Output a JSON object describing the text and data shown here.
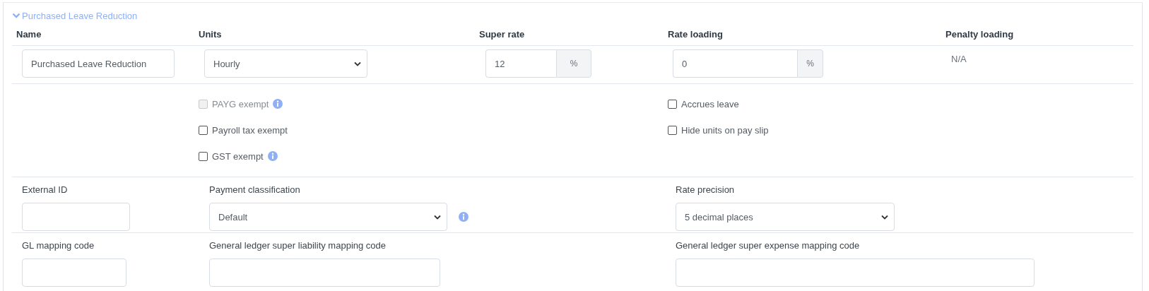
{
  "section": {
    "title": "Purchased Leave Reduction",
    "expanded": true
  },
  "columns": [
    "Name",
    "Units",
    "Super rate",
    "Rate loading",
    "Penalty loading"
  ],
  "name_field": {
    "value": "Purchased Leave Reduction"
  },
  "units_select": {
    "value": "Hourly"
  },
  "super_rate": {
    "value": "12",
    "suffix": "%"
  },
  "rate_loading": {
    "value": "0",
    "suffix": "%"
  },
  "penalty_loading": "N/A",
  "options_left": [
    {
      "label": "PAYG exempt",
      "checked": false,
      "disabled": true,
      "info": true
    },
    {
      "label": "Payroll tax exempt",
      "checked": false,
      "disabled": false,
      "info": false
    },
    {
      "label": "GST exempt",
      "checked": false,
      "disabled": false,
      "info": true
    }
  ],
  "options_right": [
    {
      "label": "Accrues leave",
      "checked": false,
      "disabled": false,
      "info": false
    },
    {
      "label": "Hide units on pay slip",
      "checked": false,
      "disabled": false,
      "info": false
    }
  ],
  "field_rows": [
    [
      {
        "label": "External ID",
        "kind": "input"
      },
      {
        "label": "Payment classification",
        "kind": "select",
        "value": "Default",
        "info": true
      },
      {
        "label": "Rate precision",
        "kind": "select",
        "value": "5 decimal places",
        "info": false
      }
    ],
    [
      {
        "label": "GL mapping code",
        "kind": "input"
      },
      {
        "label": "General ledger super liability mapping code",
        "kind": "input"
      },
      {
        "label": "General ledger super expense mapping code",
        "kind": "input"
      }
    ]
  ]
}
